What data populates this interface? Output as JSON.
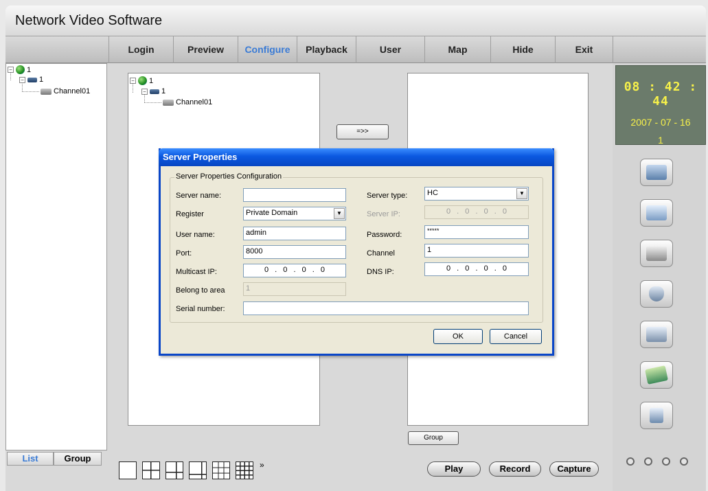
{
  "app": {
    "title": "Network Video Software"
  },
  "nav": {
    "items": [
      "Login",
      "Preview",
      "Configure",
      "Playback",
      "User",
      "Map",
      "Hide",
      "Exit"
    ],
    "active": "Configure",
    "active_color": "#3a7bd5"
  },
  "left_tree": {
    "root": "1",
    "device": "1",
    "channel": "Channel01"
  },
  "config_tree": {
    "root": "1",
    "device": "1",
    "channel": "Channel01"
  },
  "buttons": {
    "move": "=>>",
    "group": "Group"
  },
  "clock": {
    "time": "08 : 42 : 44",
    "date": "2007 - 07 - 16",
    "number": "1"
  },
  "side_icons": [
    "server-config-icon",
    "monitor-config-icon",
    "network-config-icon",
    "security-config-icon",
    "search-config-icon",
    "map-config-icon",
    "exit-config-icon"
  ],
  "bottom": {
    "tab_list": "List",
    "tab_group": "Group",
    "more": "»",
    "play": "Play",
    "record": "Record",
    "capture": "Capture"
  },
  "dialog": {
    "title": "Server Properties",
    "group_title": "Server Properties Configuration",
    "server_name": {
      "label": "Server name:",
      "value": ""
    },
    "server_type": {
      "label": "Server type:",
      "value": "HC"
    },
    "register": {
      "label": "Register",
      "value": "Private Domain"
    },
    "server_ip": {
      "label": "Server IP:",
      "value": "0 . 0 . 0 . 0"
    },
    "user_name": {
      "label": "User name:",
      "value": "admin"
    },
    "password": {
      "label": "Password:",
      "value": "*****"
    },
    "port": {
      "label": "Port:",
      "value": "8000"
    },
    "channel": {
      "label": "Channel",
      "value": "1"
    },
    "multicast_ip": {
      "label": "Multicast IP:",
      "value": "0 . 0 . 0 . 0"
    },
    "dns_ip": {
      "label": "DNS IP:",
      "value": "0 . 0 . 0 . 0"
    },
    "belong_to_area": {
      "label": "Belong to area",
      "value": "1"
    },
    "serial_number": {
      "label": "Serial number:",
      "value": ""
    },
    "ok": "OK",
    "cancel": "Cancel"
  }
}
